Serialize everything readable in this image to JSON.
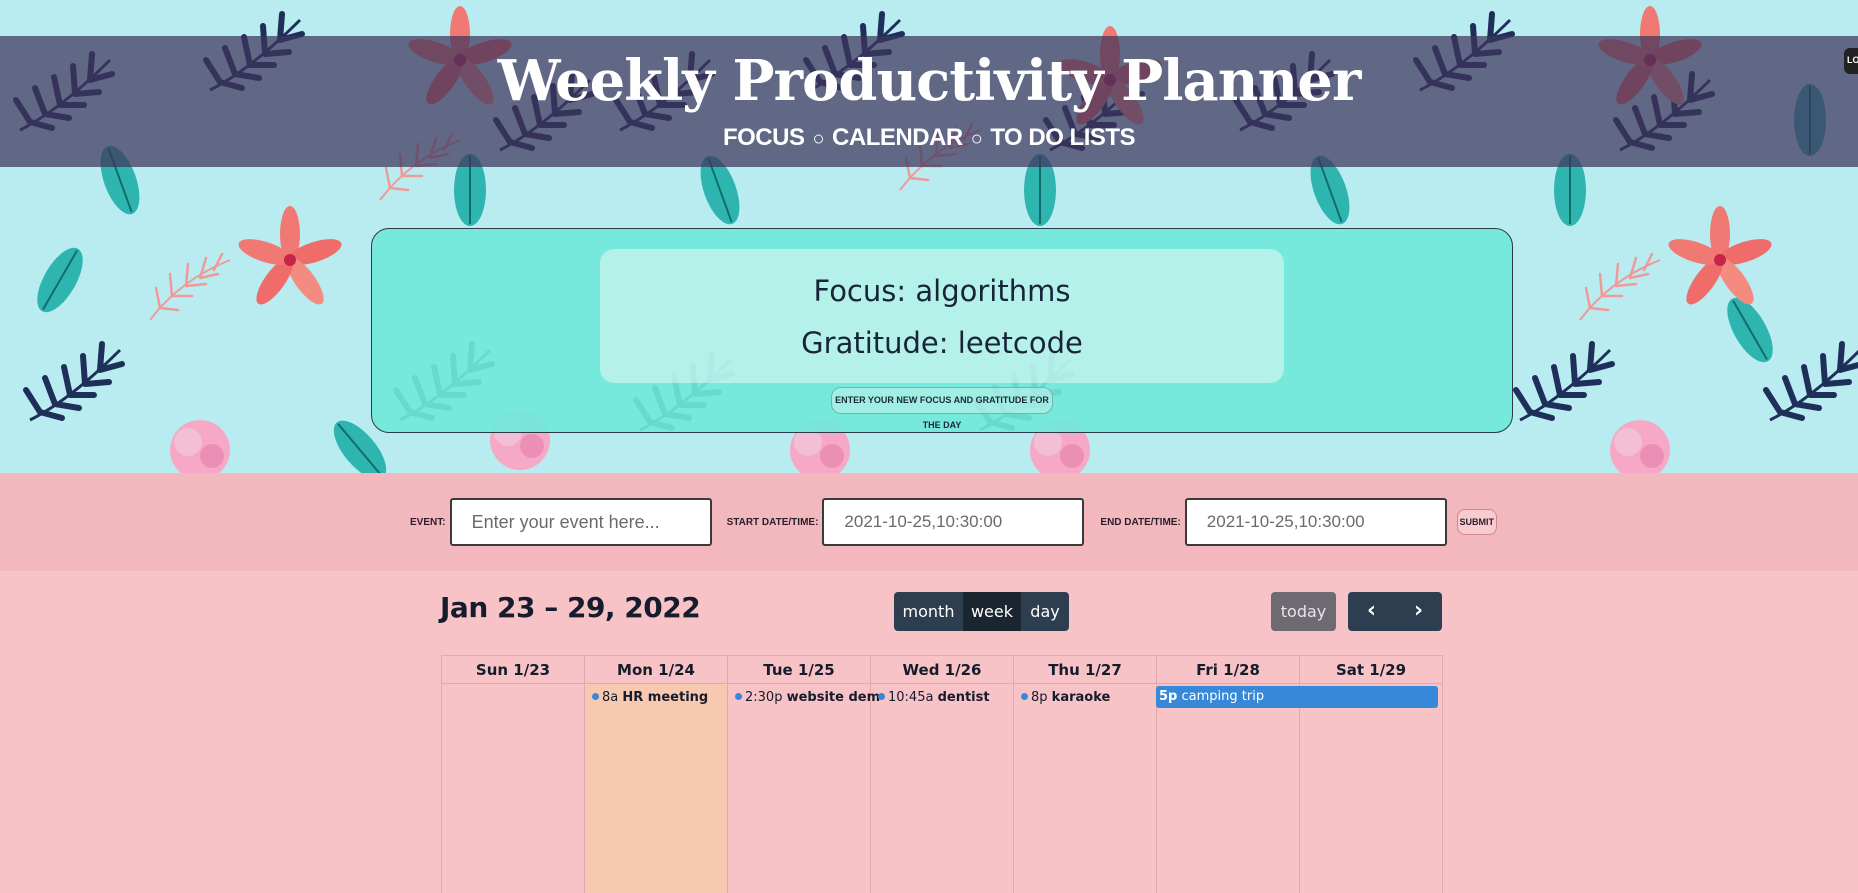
{
  "header": {
    "title": "Weekly Productivity Planner",
    "nav": [
      "FOCUS",
      "CALENDAR",
      "TO DO LISTS"
    ],
    "separator": "○",
    "edge_tag": "LO"
  },
  "focus": {
    "focus_label": "Focus:",
    "focus_value": "algorithms",
    "gratitude_label": "Gratitude:",
    "gratitude_value": "leetcode",
    "button_label": "ENTER YOUR NEW FOCUS AND GRATITUDE FOR THE DAY"
  },
  "event_form": {
    "event_label": "EVENT:",
    "event_placeholder": "Enter your event here...",
    "start_label": "START DATE/TIME:",
    "start_value": "2021-10-25,10:30:00",
    "end_label": "END DATE/TIME:",
    "end_value": "2021-10-25,10:30:00",
    "submit_label": "SUBMIT"
  },
  "calendar": {
    "range_title": "Jan 23 – 29, 2022",
    "views": [
      "month",
      "week",
      "day"
    ],
    "active_view": "week",
    "today_label": "today",
    "prev_icon": "‹",
    "next_icon": "›",
    "days": [
      {
        "label": "Sun 1/23"
      },
      {
        "label": "Mon 1/24",
        "is_today": true
      },
      {
        "label": "Tue 1/25"
      },
      {
        "label": "Wed 1/26"
      },
      {
        "label": "Thu 1/27"
      },
      {
        "label": "Fri 1/28"
      },
      {
        "label": "Sat 1/29"
      }
    ],
    "events": [
      {
        "day": "Mon 1/24",
        "time": "8a",
        "title": "HR meeting"
      },
      {
        "day": "Tue 1/25",
        "time": "2:30p",
        "title": "website dem"
      },
      {
        "day": "Wed 1/26",
        "time": "10:45a",
        "title": "dentist"
      },
      {
        "day": "Thu 1/27",
        "time": "8p",
        "title": "karaoke"
      },
      {
        "day": "Fri 1/28 – Sat 1/29",
        "time": "5p",
        "title": "camping trip"
      }
    ],
    "colors": {
      "event_blue": "#3788d8",
      "button_dark": "#2c3e50",
      "today_highlight": "#f7c9b1"
    }
  }
}
